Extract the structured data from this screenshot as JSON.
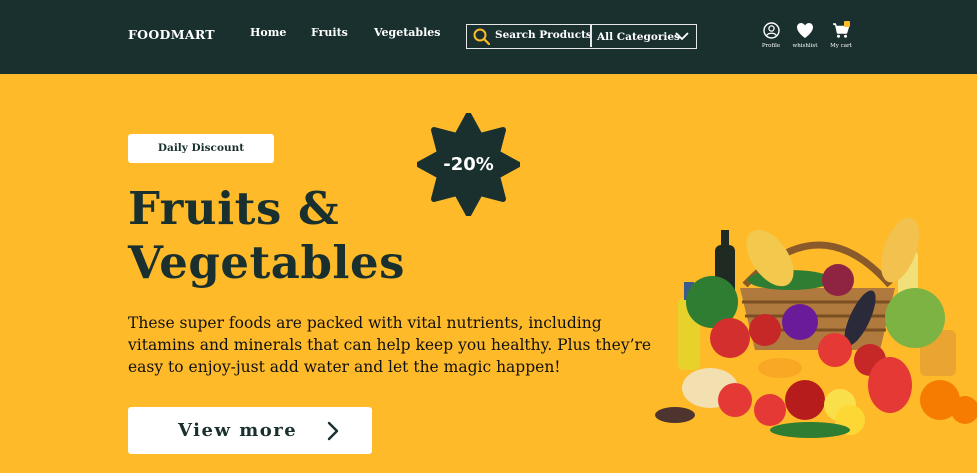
{
  "header": {
    "brand": "FOODMART",
    "nav": [
      "Home",
      "Fruits",
      "Vegetables"
    ],
    "search_label": "Search Products",
    "category_label": "All Categories",
    "icons": [
      {
        "name": "profile-icon",
        "label": "Profile"
      },
      {
        "name": "heart-icon",
        "label": "whishlist"
      },
      {
        "name": "cart-icon",
        "label": "My cart"
      }
    ]
  },
  "hero": {
    "tag": "Daily Discount",
    "discount": "-20%",
    "title_line1": "Fruits &",
    "title_line2": "Vegetables",
    "description": "These super foods are packed with vital nutrients, including vitamins and minerals that can help keep you healthy. Plus they’re easy  to enjoy-just add water and let the magic happen!",
    "cta": "View more"
  },
  "colors": {
    "header_bg": "#19302E",
    "hero_bg": "#FFBA2A",
    "accent_text": "#19302E"
  }
}
